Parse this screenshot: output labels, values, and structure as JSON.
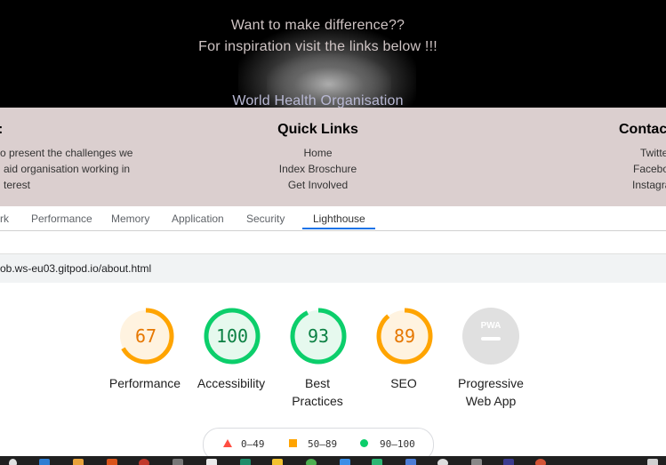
{
  "hero": {
    "line1": "Want to make difference??",
    "line2": "For inspiration visit the links below !!!",
    "link": "World Health Organisation"
  },
  "footer": {
    "left_heading_fragment": ":",
    "left_text": [
      "o present the challenges we",
      "aid organisation working in",
      "terest"
    ],
    "quick_links": {
      "heading": "Quick Links",
      "items": [
        "Home",
        "Index Broschure",
        "Get Involved"
      ]
    },
    "contact": {
      "heading": "Contac",
      "items": [
        "Twitte",
        "Facebo",
        "Instagra"
      ]
    }
  },
  "devtools": {
    "tabs": [
      "rk",
      "Performance",
      "Memory",
      "Application",
      "Security",
      "Lighthouse"
    ],
    "active_tab": "Lighthouse",
    "url": "ob.ws-eu03.gitpod.io/about.html"
  },
  "lighthouse": {
    "scores": [
      {
        "label": "Performance",
        "value": "67",
        "score": 67,
        "color": "#ffa400",
        "bg": "#fff3e0"
      },
      {
        "label": "Accessibility",
        "value": "100",
        "score": 100,
        "color": "#0cce6b",
        "bg": "#e6f9ee"
      },
      {
        "label": "Best Practices",
        "value": "93",
        "score": 93,
        "color": "#0cce6b",
        "bg": "#e6f9ee"
      },
      {
        "label": "SEO",
        "value": "89",
        "score": 89,
        "color": "#ffa400",
        "bg": "#fff3e0"
      },
      {
        "label": "Progressive Web App",
        "badge": "PWA",
        "color": "#c8c8c8",
        "bg": "#e0e0e0"
      }
    ],
    "legend": [
      "0–49",
      "50–89",
      "90–100"
    ],
    "legend_colors": [
      "#ff4e42",
      "#ffa400",
      "#0cce6b"
    ]
  }
}
